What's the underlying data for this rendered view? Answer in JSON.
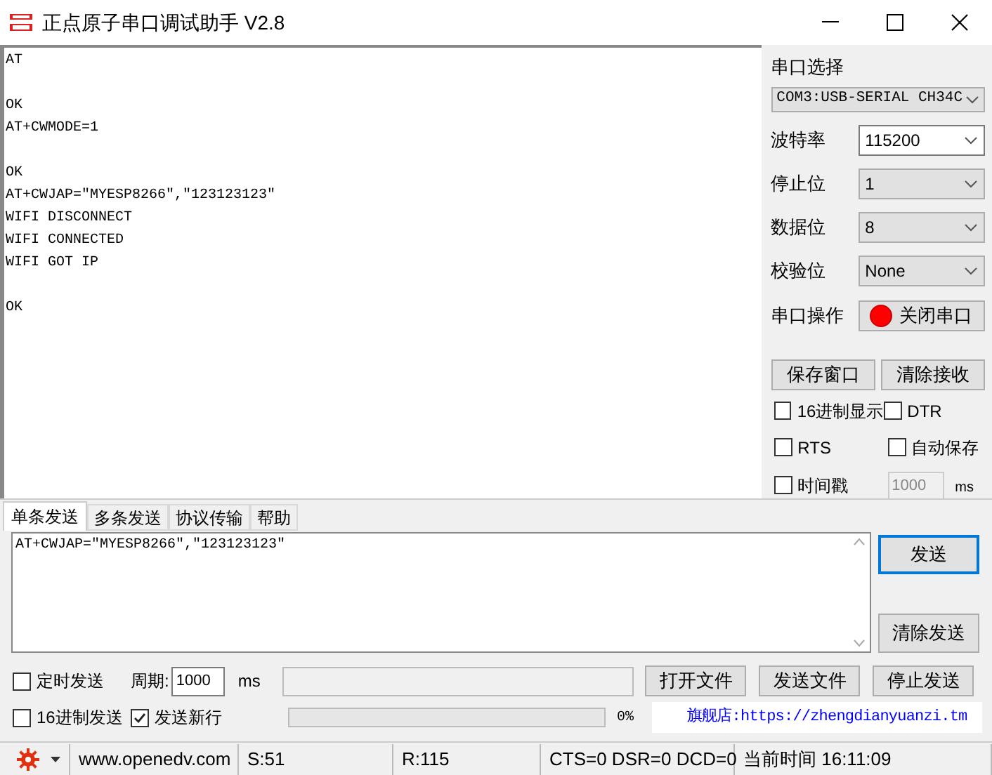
{
  "window": {
    "title": "正点原子串口调试助手 V2.8"
  },
  "receive_log": "AT\n\nOK\nAT+CWMODE=1\n\nOK\nAT+CWJAP=\"MYESP8266\",\"123123123\"\nWIFI DISCONNECT\nWIFI CONNECTED\nWIFI GOT IP\n\nOK",
  "serial_panel": {
    "port_label": "串口选择",
    "port_value": "COM3:USB-SERIAL CH34C",
    "fields": [
      {
        "label": "波特率",
        "value": "115200",
        "kind": "combo"
      },
      {
        "label": "停止位",
        "value": "1",
        "kind": "select"
      },
      {
        "label": "数据位",
        "value": "8",
        "kind": "select"
      },
      {
        "label": "校验位",
        "value": "None",
        "kind": "select"
      }
    ],
    "operation": {
      "label": "串口操作",
      "button": "关闭串口",
      "open": true
    },
    "buttons": [
      "保存窗口",
      "清除接收"
    ],
    "options": [
      {
        "label": "16进制显示",
        "checked": false
      },
      {
        "label": "DTR",
        "checked": false
      },
      {
        "label": "RTS",
        "checked": false
      },
      {
        "label": "自动保存",
        "checked": false
      },
      {
        "label": "时间戳",
        "checked": false
      }
    ],
    "timestamp_interval": {
      "value": "1000",
      "unit": "ms",
      "disabled": true
    }
  },
  "tabs": [
    {
      "label": "单条发送",
      "selected": true
    },
    {
      "label": "多条发送",
      "selected": false
    },
    {
      "label": "协议传输",
      "selected": false
    },
    {
      "label": "帮助",
      "selected": false
    }
  ],
  "send_text": "AT+CWJAP=\"MYESP8266\",\"123123123\"",
  "send_buttons": [
    "发送",
    "清除发送"
  ],
  "timed_send": {
    "label": "定时发送",
    "checked": false
  },
  "period": {
    "label": "周期:",
    "value": "1000",
    "unit": "ms"
  },
  "file_buttons": [
    "打开文件",
    "发送文件",
    "停止发送"
  ],
  "hex_send": {
    "label": "16进制发送",
    "checked": false
  },
  "send_newline": {
    "label": "发送新行",
    "checked": true
  },
  "progress": {
    "level": 0,
    "reading": "0%"
  },
  "shop_link": "旗舰店:https://zhengdianyuanzi.tm",
  "status_bar": {
    "url": "www.openedv.com",
    "sent": "S:51",
    "received": "R:115",
    "lines": "CTS=0 DSR=0 DCD=0",
    "time": "当前时间 16:11:09"
  }
}
